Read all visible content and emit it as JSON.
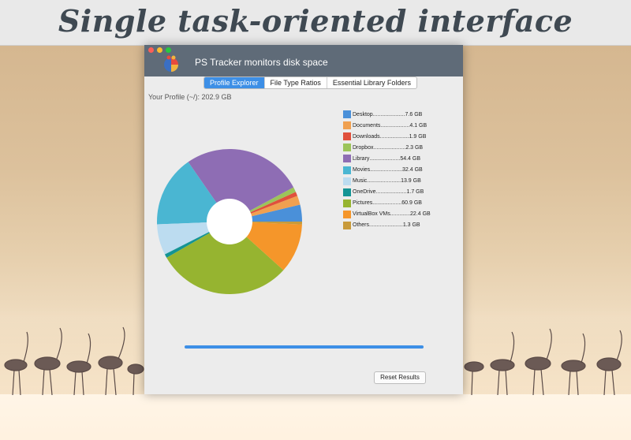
{
  "banner": {
    "title": "Single task-oriented interface"
  },
  "window": {
    "title": "PS Tracker monitors disk space",
    "tabs": [
      {
        "label": "Profile Explorer",
        "active": true
      },
      {
        "label": "File Type Ratios",
        "active": false
      },
      {
        "label": "Essential Library Folders",
        "active": false
      }
    ],
    "profile_label": "Your Profile (~/): 202.9 GB",
    "progress_fraction": 1.0,
    "reset_label": "Reset Results"
  },
  "legend": [
    {
      "label": "Desktop",
      "size": "7.6 GB",
      "color": "#4a90d9"
    },
    {
      "label": "Documents",
      "size": "4.1 GB",
      "color": "#f0a050"
    },
    {
      "label": "Downloads",
      "size": "1.9 GB",
      "color": "#e0503c"
    },
    {
      "label": "Dropbox",
      "size": "2.3 GB",
      "color": "#9cc45a"
    },
    {
      "label": "Library",
      "size": "54.4 GB",
      "color": "#8e6db4"
    },
    {
      "label": "Movies",
      "size": "32.4 GB",
      "color": "#4ab6d2"
    },
    {
      "label": "Music",
      "size": "13.9 GB",
      "color": "#bcdcf0"
    },
    {
      "label": "OneDrive",
      "size": "1.7 GB",
      "color": "#149494"
    },
    {
      "label": "Pictures",
      "size": "60.9 GB",
      "color": "#96b430"
    },
    {
      "label": "VirtualBox VMs",
      "size": "22.4 GB",
      "color": "#f5962a"
    },
    {
      "label": "Others",
      "size": "1.3 GB",
      "color": "#c89a3a"
    }
  ],
  "chart_data": {
    "type": "pie",
    "categories": [
      "Desktop",
      "Documents",
      "Downloads",
      "Dropbox",
      "Library",
      "Movies",
      "Music",
      "OneDrive",
      "Pictures",
      "VirtualBox VMs",
      "Others"
    ],
    "values": [
      7.6,
      4.1,
      1.9,
      2.3,
      54.4,
      32.4,
      13.9,
      1.7,
      60.9,
      22.4,
      1.3
    ],
    "donut": true,
    "title": "",
    "legend_position": "right"
  }
}
